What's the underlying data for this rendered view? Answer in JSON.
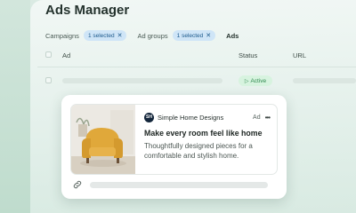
{
  "app": {
    "title": "Ads Manager"
  },
  "tabs": [
    {
      "label": "Campaigns",
      "chip": "1 selected"
    },
    {
      "label": "Ad groups",
      "chip": "1 selected"
    },
    {
      "label": "Ads"
    }
  ],
  "table": {
    "columns": {
      "ad": "Ad",
      "status": "Status",
      "url": "URL"
    },
    "row_status": "Active"
  },
  "ad_preview": {
    "brand_name": "Simple Home Designs",
    "brand_logo_text": "SH",
    "ad_label": "Ad",
    "more": "•••",
    "headline": "Make every room feel like home",
    "description": "Thoughtfully designed pieces for a comfortable and stylish home."
  },
  "colors": {
    "accent_chip": "#cfe5f7",
    "status_active": "#2f8a4f",
    "brand_logo": "#13263b"
  }
}
